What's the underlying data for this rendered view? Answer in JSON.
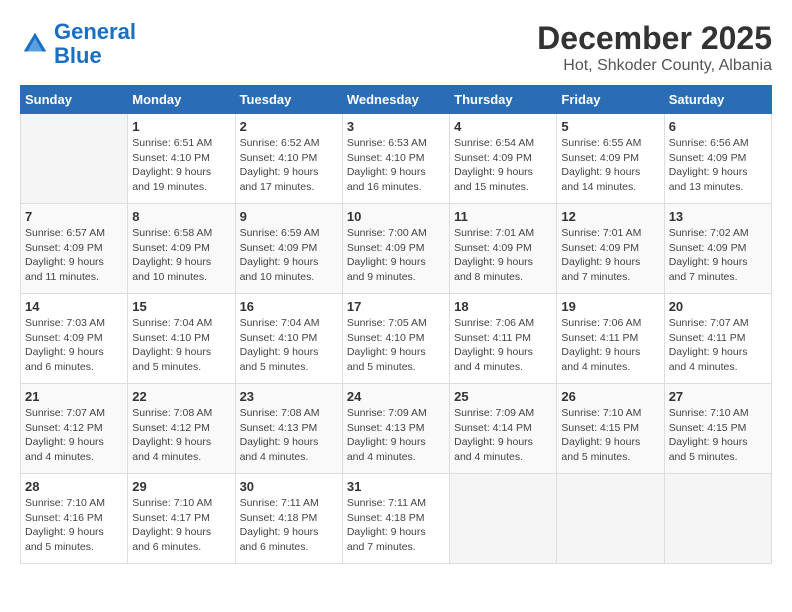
{
  "header": {
    "logo_line1": "General",
    "logo_line2": "Blue",
    "main_title": "December 2025",
    "sub_title": "Hot, Shkoder County, Albania"
  },
  "calendar": {
    "days_of_week": [
      "Sunday",
      "Monday",
      "Tuesday",
      "Wednesday",
      "Thursday",
      "Friday",
      "Saturday"
    ],
    "weeks": [
      [
        {
          "day": "",
          "info": ""
        },
        {
          "day": "1",
          "info": "Sunrise: 6:51 AM\nSunset: 4:10 PM\nDaylight: 9 hours\nand 19 minutes."
        },
        {
          "day": "2",
          "info": "Sunrise: 6:52 AM\nSunset: 4:10 PM\nDaylight: 9 hours\nand 17 minutes."
        },
        {
          "day": "3",
          "info": "Sunrise: 6:53 AM\nSunset: 4:10 PM\nDaylight: 9 hours\nand 16 minutes."
        },
        {
          "day": "4",
          "info": "Sunrise: 6:54 AM\nSunset: 4:09 PM\nDaylight: 9 hours\nand 15 minutes."
        },
        {
          "day": "5",
          "info": "Sunrise: 6:55 AM\nSunset: 4:09 PM\nDaylight: 9 hours\nand 14 minutes."
        },
        {
          "day": "6",
          "info": "Sunrise: 6:56 AM\nSunset: 4:09 PM\nDaylight: 9 hours\nand 13 minutes."
        }
      ],
      [
        {
          "day": "7",
          "info": "Sunrise: 6:57 AM\nSunset: 4:09 PM\nDaylight: 9 hours\nand 11 minutes."
        },
        {
          "day": "8",
          "info": "Sunrise: 6:58 AM\nSunset: 4:09 PM\nDaylight: 9 hours\nand 10 minutes."
        },
        {
          "day": "9",
          "info": "Sunrise: 6:59 AM\nSunset: 4:09 PM\nDaylight: 9 hours\nand 10 minutes."
        },
        {
          "day": "10",
          "info": "Sunrise: 7:00 AM\nSunset: 4:09 PM\nDaylight: 9 hours\nand 9 minutes."
        },
        {
          "day": "11",
          "info": "Sunrise: 7:01 AM\nSunset: 4:09 PM\nDaylight: 9 hours\nand 8 minutes."
        },
        {
          "day": "12",
          "info": "Sunrise: 7:01 AM\nSunset: 4:09 PM\nDaylight: 9 hours\nand 7 minutes."
        },
        {
          "day": "13",
          "info": "Sunrise: 7:02 AM\nSunset: 4:09 PM\nDaylight: 9 hours\nand 7 minutes."
        }
      ],
      [
        {
          "day": "14",
          "info": "Sunrise: 7:03 AM\nSunset: 4:09 PM\nDaylight: 9 hours\nand 6 minutes."
        },
        {
          "day": "15",
          "info": "Sunrise: 7:04 AM\nSunset: 4:10 PM\nDaylight: 9 hours\nand 5 minutes."
        },
        {
          "day": "16",
          "info": "Sunrise: 7:04 AM\nSunset: 4:10 PM\nDaylight: 9 hours\nand 5 minutes."
        },
        {
          "day": "17",
          "info": "Sunrise: 7:05 AM\nSunset: 4:10 PM\nDaylight: 9 hours\nand 5 minutes."
        },
        {
          "day": "18",
          "info": "Sunrise: 7:06 AM\nSunset: 4:11 PM\nDaylight: 9 hours\nand 4 minutes."
        },
        {
          "day": "19",
          "info": "Sunrise: 7:06 AM\nSunset: 4:11 PM\nDaylight: 9 hours\nand 4 minutes."
        },
        {
          "day": "20",
          "info": "Sunrise: 7:07 AM\nSunset: 4:11 PM\nDaylight: 9 hours\nand 4 minutes."
        }
      ],
      [
        {
          "day": "21",
          "info": "Sunrise: 7:07 AM\nSunset: 4:12 PM\nDaylight: 9 hours\nand 4 minutes."
        },
        {
          "day": "22",
          "info": "Sunrise: 7:08 AM\nSunset: 4:12 PM\nDaylight: 9 hours\nand 4 minutes."
        },
        {
          "day": "23",
          "info": "Sunrise: 7:08 AM\nSunset: 4:13 PM\nDaylight: 9 hours\nand 4 minutes."
        },
        {
          "day": "24",
          "info": "Sunrise: 7:09 AM\nSunset: 4:13 PM\nDaylight: 9 hours\nand 4 minutes."
        },
        {
          "day": "25",
          "info": "Sunrise: 7:09 AM\nSunset: 4:14 PM\nDaylight: 9 hours\nand 4 minutes."
        },
        {
          "day": "26",
          "info": "Sunrise: 7:10 AM\nSunset: 4:15 PM\nDaylight: 9 hours\nand 5 minutes."
        },
        {
          "day": "27",
          "info": "Sunrise: 7:10 AM\nSunset: 4:15 PM\nDaylight: 9 hours\nand 5 minutes."
        }
      ],
      [
        {
          "day": "28",
          "info": "Sunrise: 7:10 AM\nSunset: 4:16 PM\nDaylight: 9 hours\nand 5 minutes."
        },
        {
          "day": "29",
          "info": "Sunrise: 7:10 AM\nSunset: 4:17 PM\nDaylight: 9 hours\nand 6 minutes."
        },
        {
          "day": "30",
          "info": "Sunrise: 7:11 AM\nSunset: 4:18 PM\nDaylight: 9 hours\nand 6 minutes."
        },
        {
          "day": "31",
          "info": "Sunrise: 7:11 AM\nSunset: 4:18 PM\nDaylight: 9 hours\nand 7 minutes."
        },
        {
          "day": "",
          "info": ""
        },
        {
          "day": "",
          "info": ""
        },
        {
          "day": "",
          "info": ""
        }
      ]
    ]
  }
}
